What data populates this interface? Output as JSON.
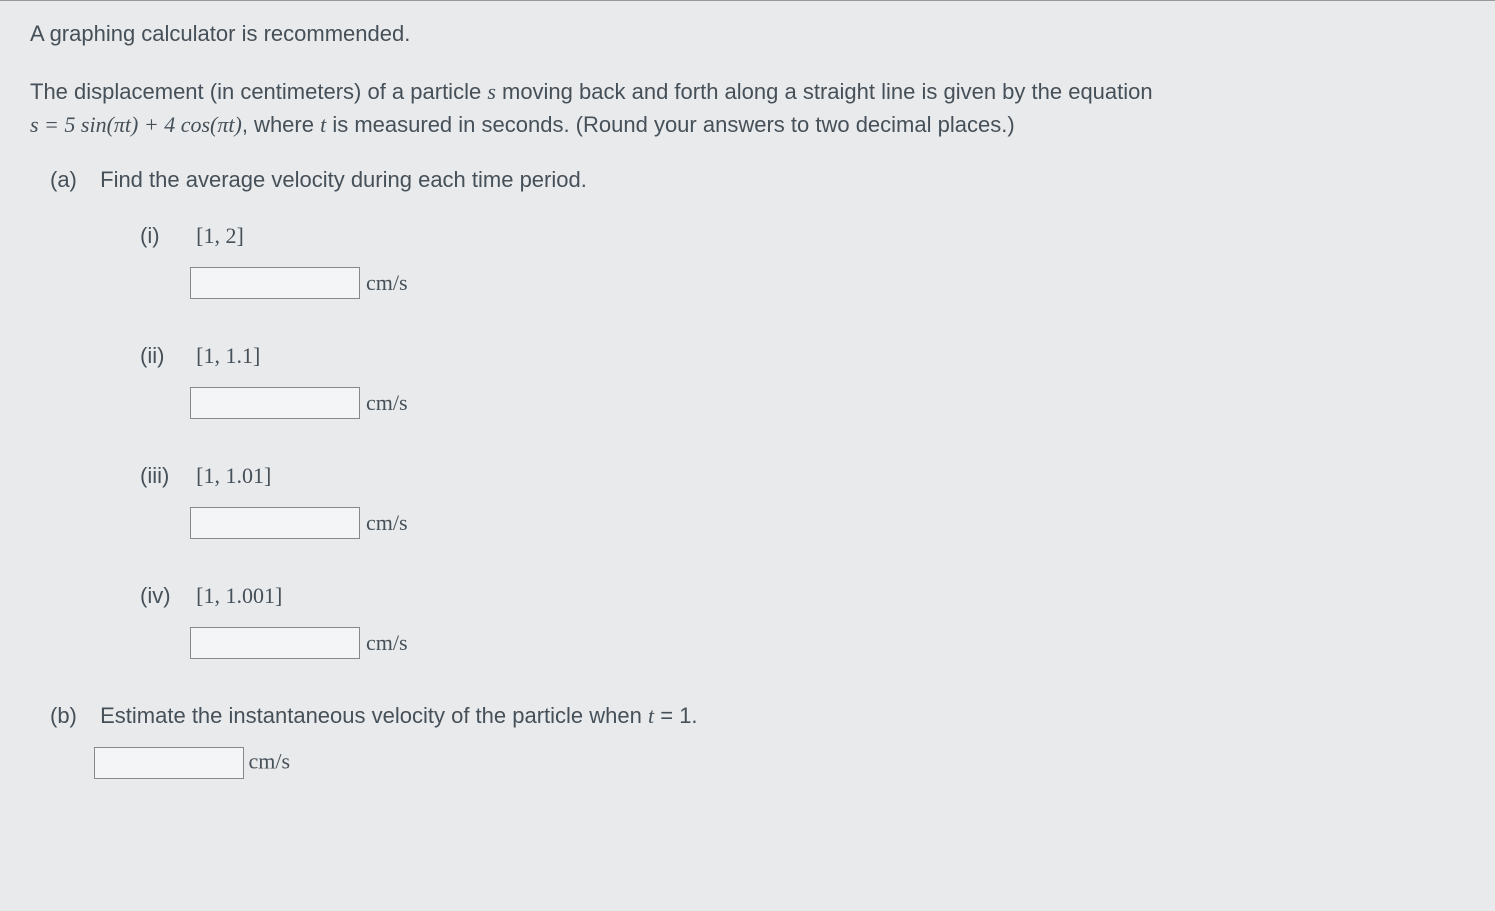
{
  "intro": "A graphing calculator is recommended.",
  "problem": {
    "text_before": "The displacement (in centimeters) of a particle ",
    "svar": "s",
    "text_mid": " moving back and forth along a straight line is given by the equation ",
    "equation": "s = 5 sin(πt) + 4 cos(πt)",
    "text_after1": ", where ",
    "tvar": "t",
    "text_after2": " is measured in seconds. (Round your answers to two decimal places.)"
  },
  "part_a": {
    "label": "(a)",
    "text": "Find the average velocity during each time period.",
    "items": [
      {
        "roman": "(i)",
        "interval": "[1, 2]",
        "unit": "cm/s"
      },
      {
        "roman": "(ii)",
        "interval": "[1, 1.1]",
        "unit": "cm/s"
      },
      {
        "roman": "(iii)",
        "interval": "[1, 1.01]",
        "unit": "cm/s"
      },
      {
        "roman": "(iv)",
        "interval": "[1, 1.001]",
        "unit": "cm/s"
      }
    ]
  },
  "part_b": {
    "label": "(b)",
    "text_before": "Estimate the instantaneous velocity of the particle when ",
    "tvar": "t",
    "equals": " = 1.",
    "unit": "cm/s"
  }
}
